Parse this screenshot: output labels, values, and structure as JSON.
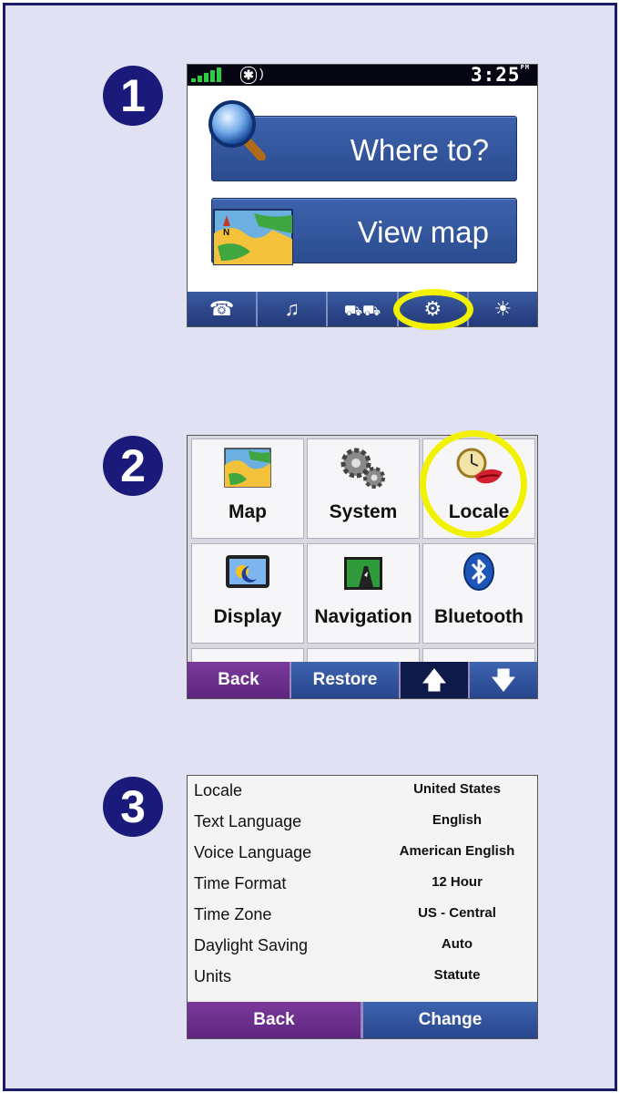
{
  "steps": [
    "1",
    "2",
    "3"
  ],
  "screen1": {
    "status": {
      "time": "3:25",
      "ampm": "PM",
      "bluetooth_icon": "bluetooth-status-icon"
    },
    "where_to_label": "Where to?",
    "view_map_label": "View map",
    "toolbar": [
      {
        "icon": "phone-icon",
        "glyph": "☎"
      },
      {
        "icon": "music-icon",
        "glyph": "♫"
      },
      {
        "icon": "traffic-icon",
        "glyph": "🚗"
      },
      {
        "icon": "tools-icon",
        "glyph": "🔧"
      },
      {
        "icon": "brightness-icon",
        "glyph": "☀"
      }
    ],
    "highlight": "tools-icon"
  },
  "screen2": {
    "tiles": [
      {
        "label": "Map",
        "icon": "map-icon"
      },
      {
        "label": "System",
        "icon": "gears-icon"
      },
      {
        "label": "Locale",
        "icon": "locale-icon"
      },
      {
        "label": "Display",
        "icon": "display-icon"
      },
      {
        "label": "Navigation",
        "icon": "navigation-icon"
      },
      {
        "label": "Bluetooth",
        "icon": "bluetooth-icon"
      }
    ],
    "back_label": "Back",
    "restore_label": "Restore",
    "highlight": "Locale"
  },
  "screen3": {
    "rows": [
      {
        "key": "Locale",
        "value": "United States"
      },
      {
        "key": "Text Language",
        "value": "English"
      },
      {
        "key": "Voice Language",
        "value": "American English"
      },
      {
        "key": "Time Format",
        "value": "12 Hour"
      },
      {
        "key": "Time Zone",
        "value": "US - Central"
      },
      {
        "key": "Daylight Saving",
        "value": "Auto"
      },
      {
        "key": "Units",
        "value": "Statute"
      }
    ],
    "back_label": "Back",
    "change_label": "Change"
  },
  "colors": {
    "frame_bg": "#e1e1f4",
    "frame_border": "#1a1a6e",
    "button_blue": "#2b4c8f",
    "button_purple": "#5e2680",
    "highlight_yellow": "#f2f200"
  }
}
